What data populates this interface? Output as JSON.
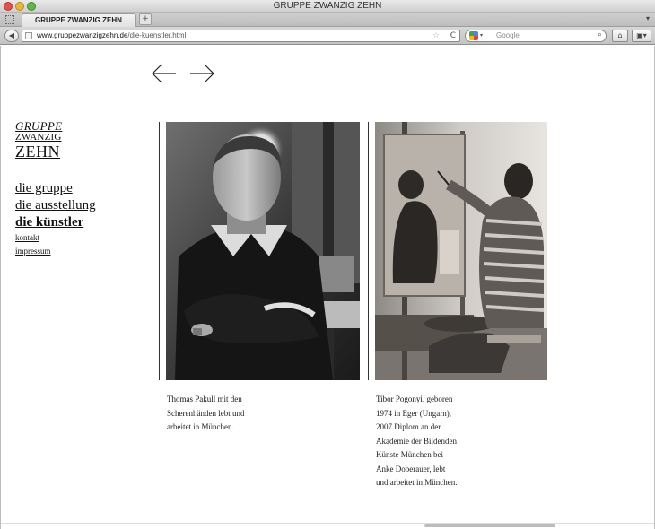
{
  "window": {
    "title": "GRUPPE ZWANZIG ZEHN",
    "tab_label": "GRUPPE ZWANZIG ZEHN",
    "tab_add": "+",
    "tab_menu": "▾"
  },
  "toolbar": {
    "back": "◀",
    "url_domain": "www.gruppezwanzigzehn.de",
    "url_path": "/die-kuenstler.html",
    "star": "☆",
    "reload": "C",
    "search_placeholder": "Google",
    "search_arrow": "▾",
    "search_icon": "⌕",
    "home": "⌂",
    "bookmarks": "▣▾"
  },
  "logo": {
    "line1": "GRUPPE",
    "line2": "ZWANZIG",
    "line3": "ZEHN"
  },
  "nav": {
    "items": [
      {
        "label": "die gruppe"
      },
      {
        "label": "die ausstellung"
      },
      {
        "label": "die künstler"
      },
      {
        "label": "kontakt"
      },
      {
        "label": "impressum"
      }
    ]
  },
  "artists": [
    {
      "name": "Thomas Pakull",
      "lines": [
        " mit den",
        "Scherenhänden lebt und",
        "arbeitet in München."
      ]
    },
    {
      "name": "Tibor Pogonyi",
      "lines": [
        ", geboren",
        "1974 in Eger (Ungarn),",
        "2007 Diplom an der",
        "Akademie der Bildenden",
        "Künste München bei",
        "Anke Doberauer, lebt",
        "und arbeitet in München."
      ]
    }
  ],
  "colors": {
    "text": "#111111",
    "background": "#ffffff"
  },
  "icons": {
    "prev": "arrow-left-icon",
    "next": "arrow-right-icon"
  }
}
